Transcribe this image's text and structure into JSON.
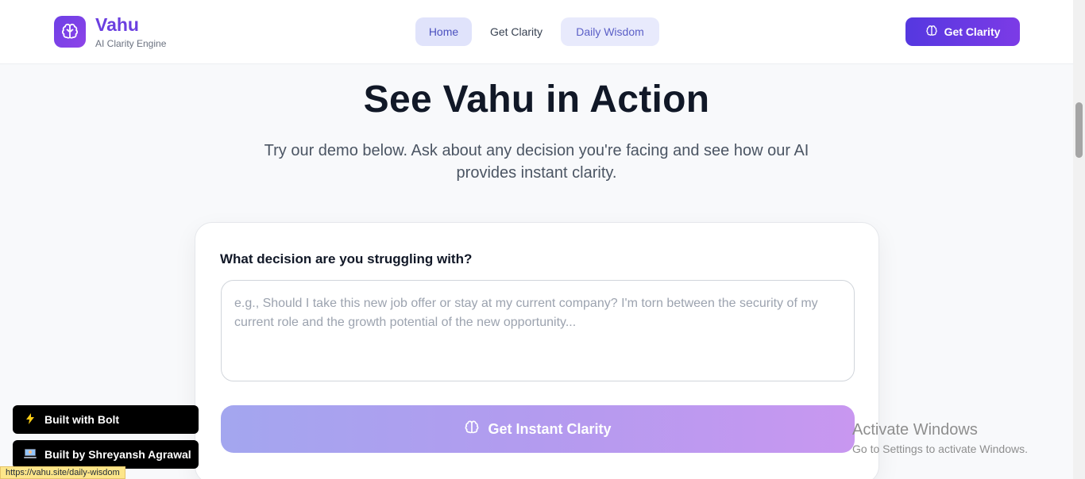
{
  "header": {
    "brand_name": "Vahu",
    "brand_tagline": "AI Clarity Engine",
    "nav": [
      {
        "label": "Home"
      },
      {
        "label": "Get Clarity"
      },
      {
        "label": "Daily Wisdom"
      }
    ],
    "cta_label": "Get Clarity"
  },
  "hero": {
    "title": "See Vahu in Action",
    "subtitle": "Try our demo below. Ask about any decision you're facing and see how our AI provides instant clarity."
  },
  "demo": {
    "question_label": "What decision are you struggling with?",
    "textarea_placeholder": "e.g., Should I take this new job offer or stay at my current company? I'm torn between the security of my current role and the growth potential of the new opportunity...",
    "submit_label": "Get Instant Clarity"
  },
  "badges": {
    "bolt": "Built with Bolt",
    "author": "Built by Shreyansh Agrawal"
  },
  "watermark": {
    "title": "Activate Windows",
    "subtitle": "Go to Settings to activate Windows."
  },
  "status_bar": {
    "url": "https://vahu.site/daily-wisdom"
  },
  "colors": {
    "brand": "#6b3fe0",
    "cta_start": "#5538e0",
    "cta_end": "#7c3be6"
  }
}
